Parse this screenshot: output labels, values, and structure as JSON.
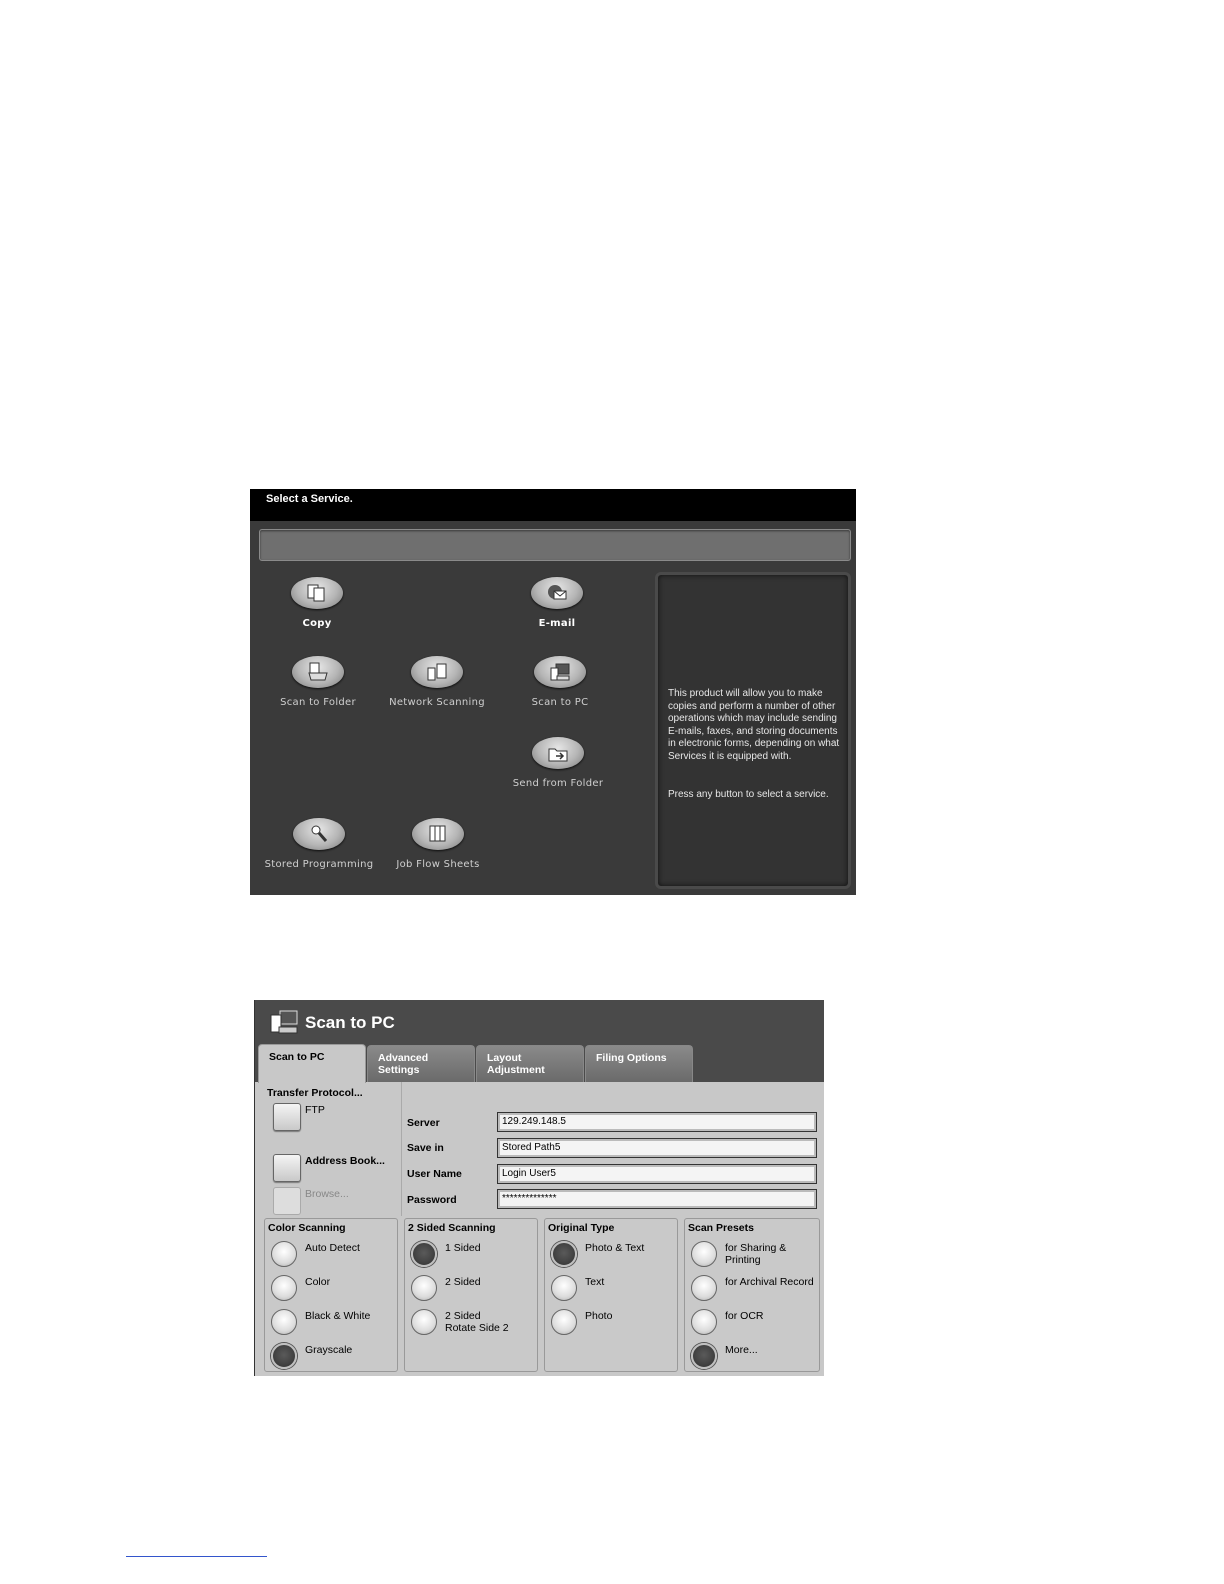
{
  "service_screen": {
    "header": "Select a Service.",
    "services": [
      {
        "label": "Copy",
        "icon": "copy-icon"
      },
      {
        "label": "E-mail",
        "icon": "email-icon"
      },
      {
        "label": "Scan to Folder",
        "icon": "scan-to-folder-icon"
      },
      {
        "label": "Network Scanning",
        "icon": "network-scanning-icon"
      },
      {
        "label": "Scan to PC",
        "icon": "scan-to-pc-icon"
      },
      {
        "label": "Send from Folder",
        "icon": "send-from-folder-icon"
      },
      {
        "label": "Stored Programming",
        "icon": "stored-programming-icon"
      },
      {
        "label": "Job Flow Sheets",
        "icon": "job-flow-sheets-icon"
      }
    ],
    "info_text": "This product will allow you to make copies and perform a number of other operations which may include sending E-mails, faxes, and storing documents in electronic forms, depending on what Services it is equipped with.",
    "info_prompt": "Press any button to select a service."
  },
  "scan_to_pc": {
    "title": "Scan to PC",
    "tabs": [
      {
        "label": "Scan to PC"
      },
      {
        "label": "Advanced Settings"
      },
      {
        "label": "Layout Adjustment"
      },
      {
        "label": "Filing Options"
      }
    ],
    "transfer_protocol_label": "Transfer Protocol...",
    "protocol_value": "FTP",
    "address_book_label": "Address Book...",
    "browse_label": "Browse...",
    "fields": [
      {
        "label": "Server",
        "value": "129.249.148.5"
      },
      {
        "label": "Save in",
        "value": "Stored Path5"
      },
      {
        "label": "User Name",
        "value": "Login User5"
      },
      {
        "label": "Password",
        "value": "**************"
      }
    ],
    "groups": [
      {
        "title": "Color Scanning",
        "options": [
          "Auto Detect",
          "Color",
          "Black & White",
          "Grayscale"
        ],
        "selected": 3
      },
      {
        "title": "2 Sided Scanning",
        "options": [
          "1 Sided",
          "2 Sided",
          "2 Sided Rotate Side 2"
        ],
        "selected": 0
      },
      {
        "title": "Original Type",
        "options": [
          "Photo & Text",
          "Text",
          "Photo"
        ],
        "selected": 0
      },
      {
        "title": "Scan Presets",
        "options": [
          "for Sharing & Printing",
          "for Archival Record",
          "for OCR",
          "More..."
        ],
        "selected": 3
      }
    ]
  }
}
